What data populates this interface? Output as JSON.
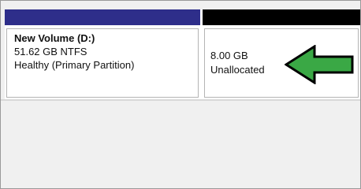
{
  "disk": {
    "volume": {
      "title": "New Volume  (D:)",
      "size": "51.62 GB NTFS",
      "status": "Healthy (Primary Partition)",
      "stripe_color": "#2e2e8a"
    },
    "unallocated": {
      "size": "8.00 GB",
      "status": "Unallocated",
      "stripe_color": "#000000"
    }
  },
  "annotation": {
    "arrow_icon": "green-left-arrow-icon",
    "arrow_color": "#3aa845"
  }
}
